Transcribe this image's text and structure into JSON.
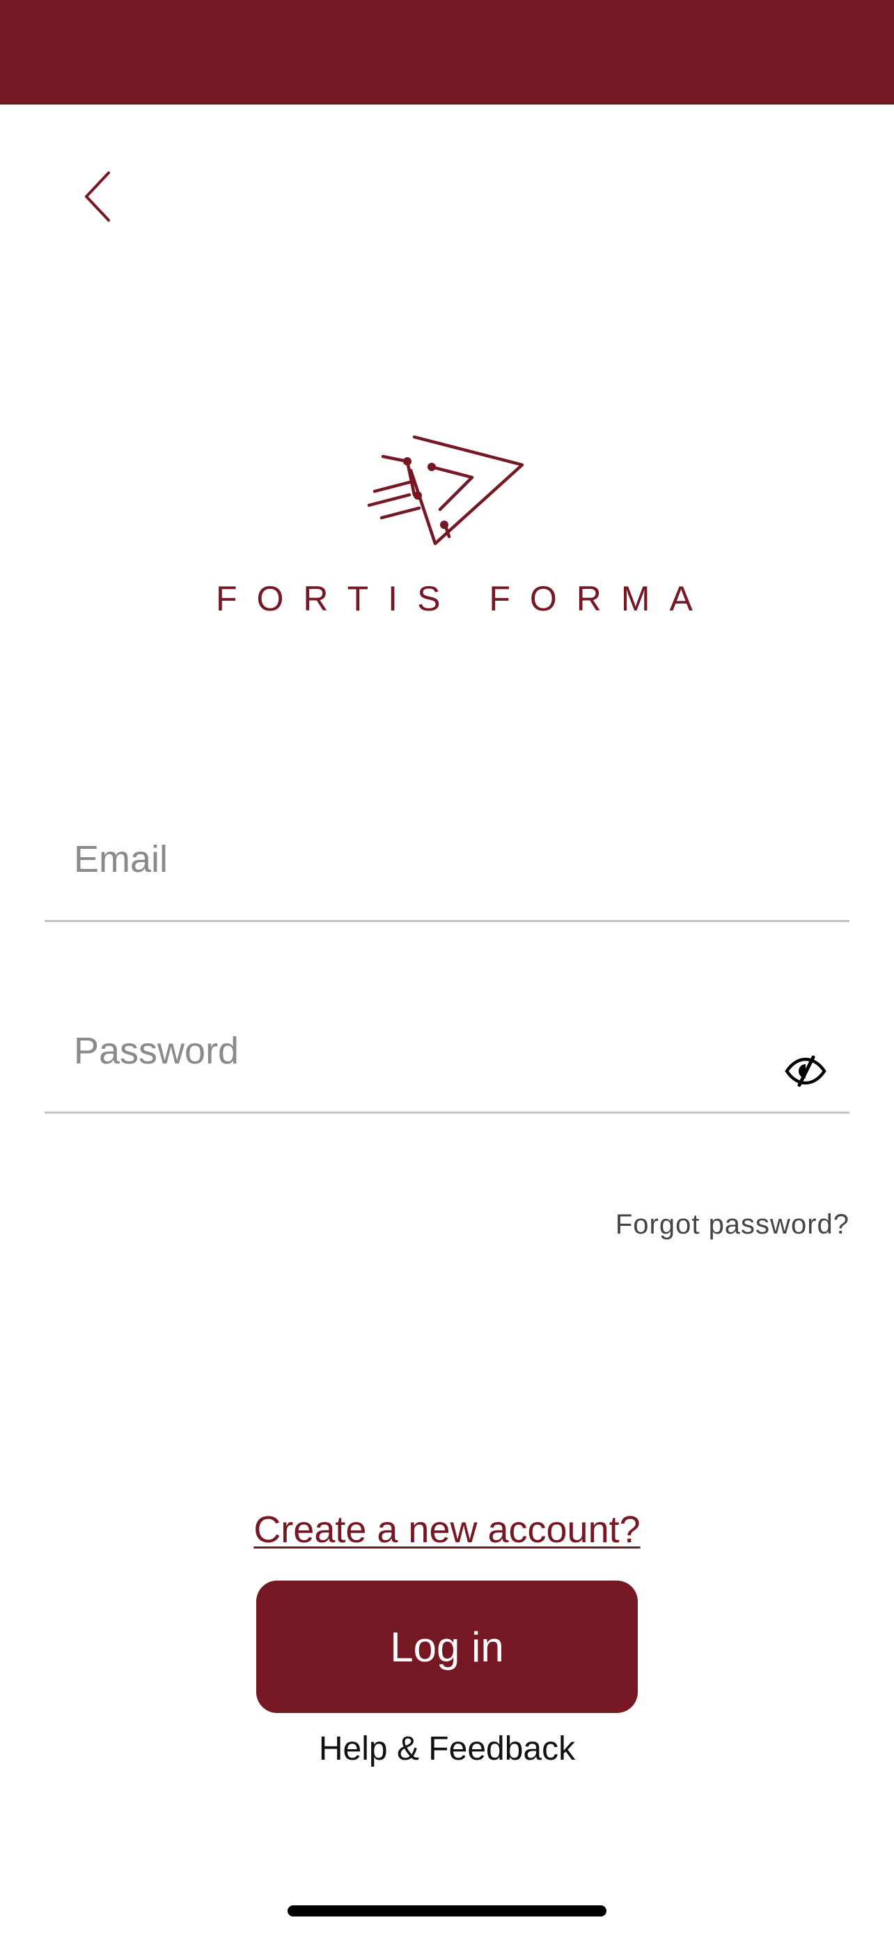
{
  "colors": {
    "brand": "#751823",
    "placeholder": "#8a8a8a",
    "divider": "#c4c4c4",
    "link_gray": "#444444"
  },
  "header": {
    "back_icon": "chevron-left-icon"
  },
  "logo": {
    "text": "FORTIS FORMA",
    "mark_icon": "fortis-forma-logo-mark"
  },
  "form": {
    "email": {
      "placeholder": "Email",
      "value": ""
    },
    "password": {
      "placeholder": "Password",
      "value": "",
      "toggle_icon": "eye-slash-icon"
    },
    "forgot_password_label": "Forgot password?"
  },
  "actions": {
    "create_account_label": "Create a new account?",
    "login_label": "Log in",
    "help_label": "Help & Feedback"
  }
}
